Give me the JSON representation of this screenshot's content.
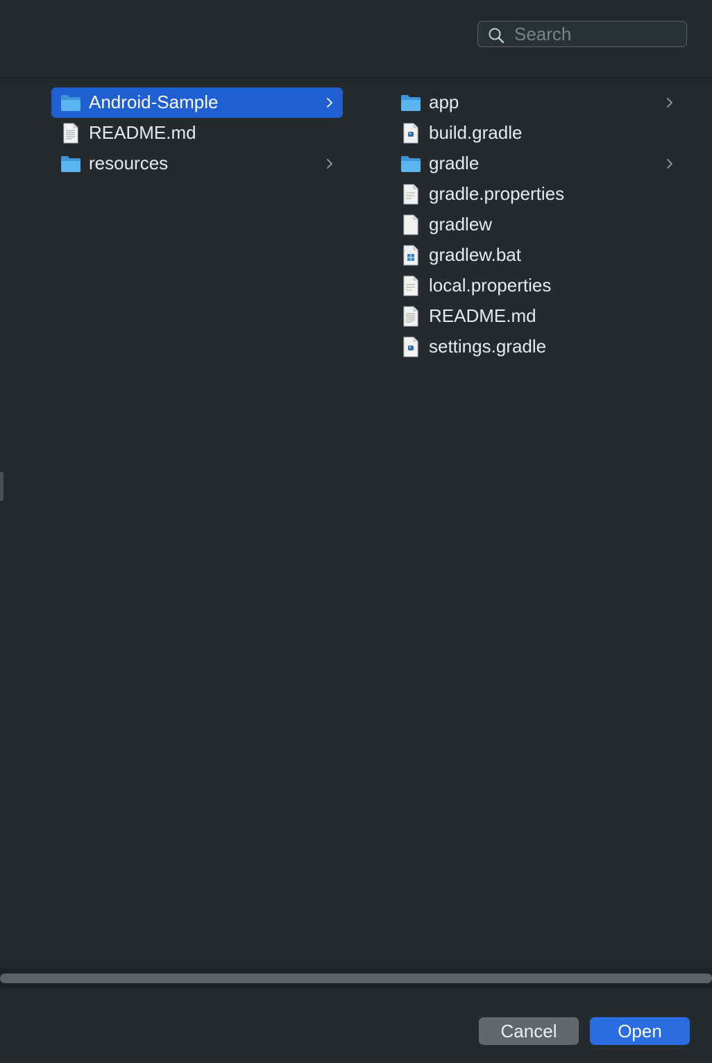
{
  "search": {
    "placeholder": "Search"
  },
  "column1": {
    "items": [
      {
        "label": "Android-Sample",
        "icon": "folder-icon",
        "selected": true,
        "has_children": true
      },
      {
        "label": "README.md",
        "icon": "markdown-file-icon",
        "selected": false,
        "has_children": false
      },
      {
        "label": "resources",
        "icon": "folder-icon",
        "selected": false,
        "has_children": true
      }
    ]
  },
  "column2": {
    "items": [
      {
        "label": "app",
        "icon": "folder-icon",
        "has_children": true
      },
      {
        "label": "build.gradle",
        "icon": "gradle-file-icon",
        "has_children": false
      },
      {
        "label": "gradle",
        "icon": "folder-icon",
        "has_children": true
      },
      {
        "label": "gradle.properties",
        "icon": "text-file-icon",
        "has_children": false
      },
      {
        "label": "gradlew",
        "icon": "blank-file-icon",
        "has_children": false
      },
      {
        "label": "gradlew.bat",
        "icon": "batch-file-icon",
        "has_children": false
      },
      {
        "label": "local.properties",
        "icon": "text-file-icon",
        "has_children": false
      },
      {
        "label": "README.md",
        "icon": "markdown-file-icon",
        "has_children": false
      },
      {
        "label": "settings.gradle",
        "icon": "gradle-file-icon",
        "has_children": false
      }
    ]
  },
  "footer": {
    "cancel_label": "Cancel",
    "open_label": "Open"
  },
  "colors": {
    "accent": "#1f5fd1",
    "open_button": "#2a6de0",
    "folder": "#4aa8e8",
    "background": "#242a2e"
  }
}
